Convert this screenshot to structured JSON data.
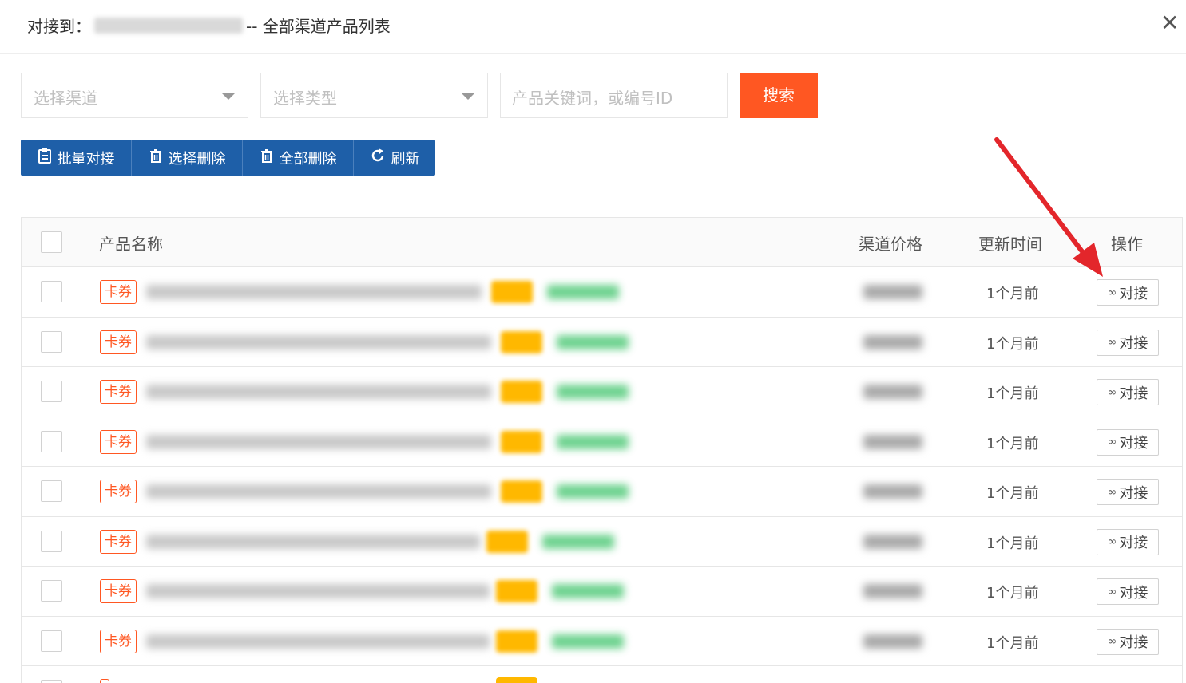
{
  "header": {
    "title_prefix": "对接到：",
    "title_suffix": "-- 全部渠道产品列表",
    "close_label": "✕"
  },
  "filters": {
    "channel_placeholder": "选择渠道",
    "type_placeholder": "选择类型",
    "keyword_placeholder": "产品关键词，或编号ID",
    "search_label": "搜索"
  },
  "toolbar": {
    "batch_label": "批量对接",
    "select_delete_label": "选择删除",
    "delete_all_label": "全部删除",
    "refresh_label": "刷新"
  },
  "table": {
    "columns": [
      "产品名称",
      "渠道价格",
      "更新时间",
      "操作"
    ],
    "rows": [
      {
        "tag": "卡券",
        "time": "1个月前",
        "action": "对接"
      },
      {
        "tag": "卡券",
        "time": "1个月前",
        "action": "对接"
      },
      {
        "tag": "卡券",
        "time": "1个月前",
        "action": "对接"
      },
      {
        "tag": "卡券",
        "time": "1个月前",
        "action": "对接"
      },
      {
        "tag": "卡券",
        "time": "1个月前",
        "action": "对接"
      },
      {
        "tag": "卡券",
        "time": "1个月前",
        "action": "对接"
      },
      {
        "tag": "卡券",
        "time": "1个月前",
        "action": "对接"
      },
      {
        "tag": "卡券",
        "time": "1个月前",
        "action": "对接"
      }
    ]
  },
  "colors": {
    "primary_blue": "#1e5fa8",
    "search_orange": "#ff5722",
    "tag_orange": "#ff5722",
    "badge_yellow": "#ffb800",
    "arrow_red": "#e3262b"
  }
}
